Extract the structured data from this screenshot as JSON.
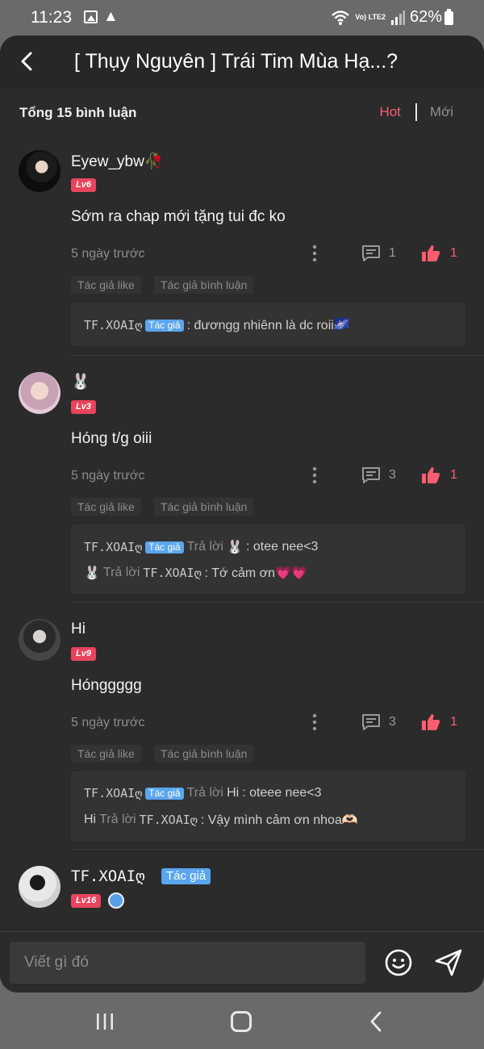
{
  "status_bar": {
    "time": "11:23",
    "network": "Vo) LTE2",
    "battery": "62%"
  },
  "header": {
    "title": "[ Thụy Nguyên ] Trái Tim Mùa Hạ...?"
  },
  "summary": {
    "total": "Tổng 15 bình luận",
    "sort_hot": "Hot",
    "sort_new": "Mới"
  },
  "comments": [
    {
      "name": "Eyew_ybw🥀",
      "level": "Lv6",
      "text": "Sớm ra chap mới tặng tui đc ko",
      "time": "5 ngày trước",
      "reply_count": "1",
      "like_count": "1",
      "tag_like": "Tác giả like",
      "tag_comment": "Tác giả bình luận",
      "replies": [
        {
          "author": "TF.XOAIღ",
          "badge": "Tác giả",
          "text": ": đươngg nhiênn là dc roii🌌"
        }
      ]
    },
    {
      "name": "🐰",
      "level": "Lv3",
      "text": "Hóng t/g oiii",
      "time": "5 ngày trước",
      "reply_count": "3",
      "like_count": "1",
      "tag_like": "Tác giả like",
      "tag_comment": "Tác giả bình luận",
      "replies": [
        {
          "author": "TF.XOAIღ",
          "badge": "Tác giả",
          "mid": "Trả lời",
          "target": "🐰",
          "text": ": otee nee<3"
        },
        {
          "author": "🐰",
          "mid": "Trả lời",
          "target": "TF.XOAIღ",
          "text": ": Tớ cảm ơn💗💗"
        }
      ]
    },
    {
      "name": "Hi",
      "level": "Lv9",
      "text": "Hónggggg",
      "time": "5 ngày trước",
      "reply_count": "3",
      "like_count": "1",
      "tag_like": "Tác giả like",
      "tag_comment": "Tác giả bình luận",
      "replies": [
        {
          "author": "TF.XOAIღ",
          "badge": "Tác giả",
          "mid": "Trả lời",
          "target": "Hi",
          "text": ": oteee nee<3"
        },
        {
          "author": "Hi",
          "mid": "Trả lời",
          "target": "TF.XOAIღ",
          "text": ": Vậy mình cảm ơn nhoa🫶🏻"
        }
      ]
    },
    {
      "name": "TF.XOAIღ",
      "badge": "Tác giả",
      "level": "Lv16"
    }
  ],
  "input": {
    "placeholder": "Viết gì đó"
  },
  "colors": {
    "accent": "#ff5c6f",
    "level_badge": "#e8445c",
    "author_badge": "#5aa6ef",
    "background": "#2b2b2b"
  },
  "icons": [
    "image-icon",
    "warning-icon",
    "wifi-icon",
    "signal-icon",
    "battery-icon",
    "back-icon",
    "more-icon",
    "comment-icon",
    "thumbs-up-icon",
    "emoji-icon",
    "send-icon",
    "recents-icon",
    "home-icon",
    "nav-back-icon"
  ]
}
